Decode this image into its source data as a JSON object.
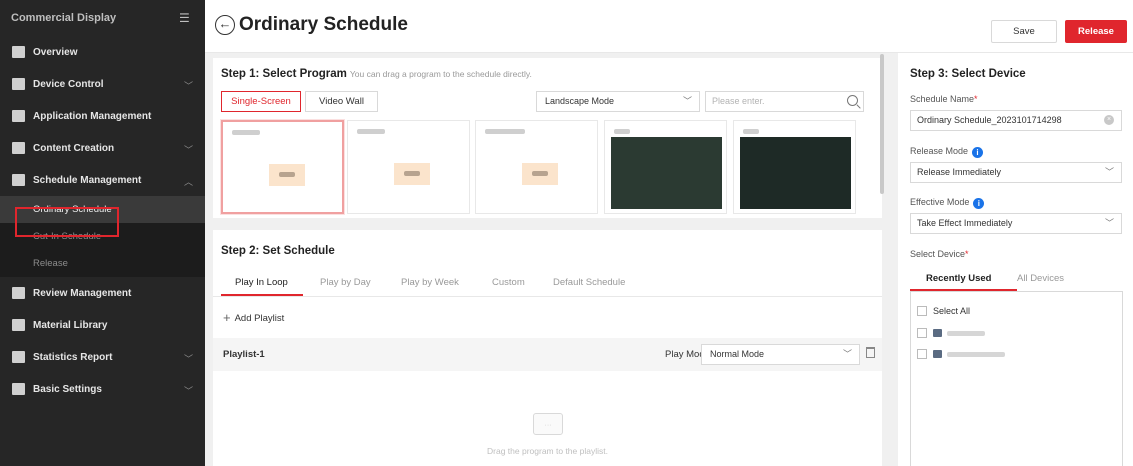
{
  "sidebar": {
    "title": "Commercial Display",
    "items": [
      {
        "label": "Overview"
      },
      {
        "label": "Device Control"
      },
      {
        "label": "Application Management"
      },
      {
        "label": "Content Creation"
      },
      {
        "label": "Schedule Management"
      },
      {
        "label": "Review Management"
      },
      {
        "label": "Material Library"
      },
      {
        "label": "Statistics Report"
      },
      {
        "label": "Basic Settings"
      }
    ],
    "schedule_sub": [
      {
        "label": "Ordinary Schedule"
      },
      {
        "label": "Cut-In Schedule"
      },
      {
        "label": "Release"
      }
    ]
  },
  "header": {
    "title": "Ordinary Schedule",
    "save_label": "Save",
    "release_label": "Release"
  },
  "step1": {
    "title": "Step 1: Select Program",
    "hint": "You can drag a program to the schedule directly.",
    "tabs": [
      "Single-Screen",
      "Video Wall"
    ],
    "orientation": "Landscape Mode",
    "search_placeholder": "Please enter."
  },
  "step2": {
    "title": "Step 2: Set Schedule",
    "tabs": [
      "Play In Loop",
      "Play by Day",
      "Play by Week",
      "Custom",
      "Default Schedule"
    ],
    "add_playlist": "Add Playlist",
    "playlist_name": "Playlist-1",
    "play_mode_label": "Play Mode",
    "play_mode_value": "Normal Mode",
    "empty_hint": "Drag the program to the playlist."
  },
  "step3": {
    "title": "Step 3: Select Device",
    "schedule_name_label": "Schedule Name",
    "schedule_name_value": "Ordinary Schedule_2023101714298",
    "release_mode_label": "Release Mode",
    "release_mode_value": "Release Immediately",
    "effective_mode_label": "Effective Mode",
    "effective_mode_value": "Take Effect Immediately",
    "select_device_label": "Select Device",
    "device_tabs": [
      "Recently Used",
      "All Devices"
    ],
    "select_all": "Select All"
  },
  "colors": {
    "accent": "#e0262d",
    "sidebar_bg": "#262626",
    "info": "#1a73e8"
  }
}
